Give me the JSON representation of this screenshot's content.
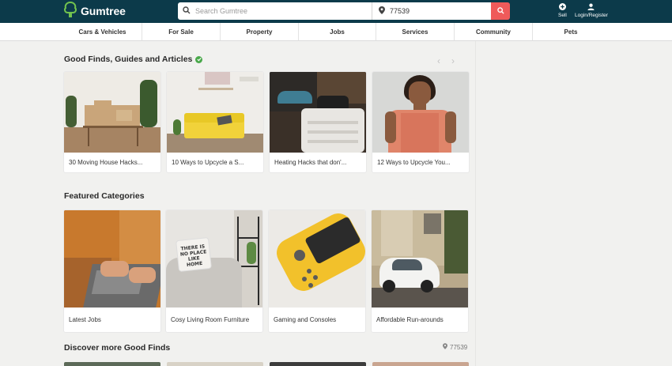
{
  "header": {
    "logo_text": "Gumtree",
    "search_placeholder": "Search Gumtree",
    "location_value": "77539",
    "sell_label": "Sell",
    "login_label": "Login/Register"
  },
  "nav": {
    "items": [
      "Cars & Vehicles",
      "For Sale",
      "Property",
      "Jobs",
      "Services",
      "Community",
      "Pets"
    ]
  },
  "good_finds": {
    "title": "Good Finds, Guides and Articles",
    "articles": [
      {
        "label": "30 Moving House Hacks..."
      },
      {
        "label": "10 Ways to Upcycle a S..."
      },
      {
        "label": "Heating Hacks that don'..."
      },
      {
        "label": "12 Ways to Upcycle You..."
      }
    ]
  },
  "featured": {
    "title": "Featured Categories",
    "categories": [
      {
        "label": "Latest Jobs"
      },
      {
        "label": "Cosy Living Room Furniture"
      },
      {
        "label": "Gaming and Consoles"
      },
      {
        "label": "Affordable Run-arounds"
      }
    ]
  },
  "discover": {
    "title": "Discover more Good Finds",
    "location": "77539"
  },
  "colors": {
    "header_bg": "#0c3a4a",
    "search_button": "#ef5a5a",
    "logo_green": "#72c24e",
    "verified_green": "#49a84a"
  }
}
